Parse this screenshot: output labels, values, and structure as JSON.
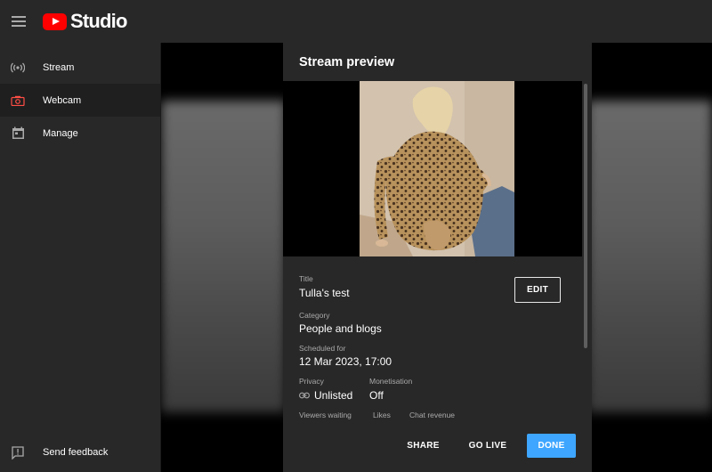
{
  "header": {
    "logo_text": "Studio"
  },
  "sidebar": {
    "items": [
      {
        "label": "Stream",
        "icon": "broadcast-icon",
        "active": false
      },
      {
        "label": "Webcam",
        "icon": "camera-icon",
        "active": true
      },
      {
        "label": "Manage",
        "icon": "calendar-icon",
        "active": false
      }
    ],
    "feedback_label": "Send feedback"
  },
  "dialog": {
    "title": "Stream preview",
    "title_label": "Title",
    "title_value": "Tulla's test",
    "edit_label": "EDIT",
    "category_label": "Category",
    "category_value": "People and blogs",
    "scheduled_label": "Scheduled for",
    "scheduled_value": "12 Mar 2023, 17:00",
    "privacy_label": "Privacy",
    "privacy_value": "Unlisted",
    "monetisation_label": "Monetisation",
    "monetisation_value": "Off",
    "stat_labels": [
      "Viewers waiting",
      "Likes",
      "Chat revenue"
    ],
    "share_label": "SHARE",
    "golive_label": "GO LIVE",
    "done_label": "DONE"
  },
  "colors": {
    "brand_red": "#ff0000",
    "accent_blue": "#3ea6ff",
    "webcam_icon": "#ff4e45"
  }
}
